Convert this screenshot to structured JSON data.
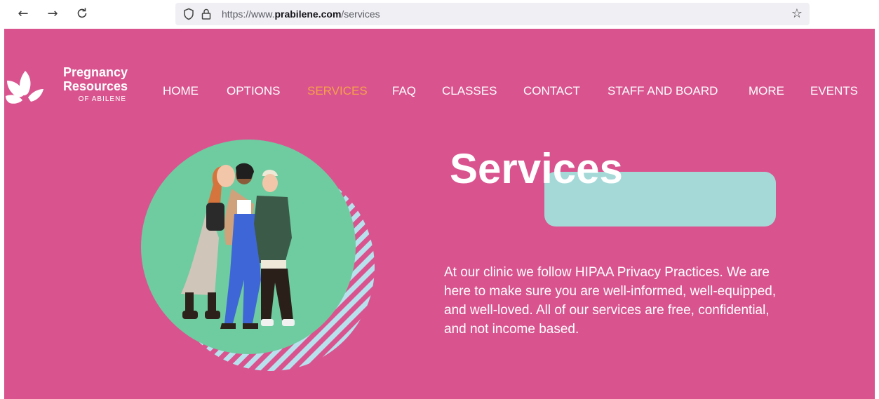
{
  "browser": {
    "back_icon": "arrow-left-icon",
    "forward_icon": "arrow-right-icon",
    "reload_icon": "reload-icon",
    "url_prefix": "https://www.",
    "url_domain": "prabilene.com",
    "url_path": "/services",
    "bookmark_icon": "star-icon"
  },
  "header": {
    "logo_line1": "Pregnancy",
    "logo_line2": "Resources",
    "logo_line3": "OF ABILENE",
    "nav": [
      {
        "label": "HOME"
      },
      {
        "label": "OPTIONS"
      },
      {
        "label": "SERVICES"
      },
      {
        "label": "FAQ"
      },
      {
        "label": "CLASSES"
      },
      {
        "label": "CONTACT"
      },
      {
        "label": "STAFF AND BOARD"
      },
      {
        "label": "MORE"
      },
      {
        "label": "EVENTS"
      }
    ],
    "active_nav": "SERVICES"
  },
  "hero": {
    "title": "Services",
    "description": "At our clinic we follow HIPAA Privacy Practices. We are here to make sure you are well-informed, well-equipped, and well-loved. All of our services are free, confidential, and not income based."
  },
  "colors": {
    "page_bg": "#d9548f",
    "active_nav": "#f5a04a",
    "title_block": "#a5d9d8",
    "circle": "#6fcba0",
    "stripes": "#b8e1ee"
  }
}
